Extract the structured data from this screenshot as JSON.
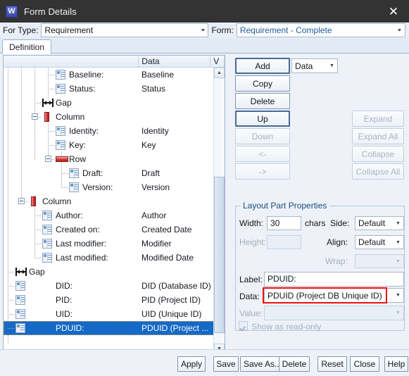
{
  "window": {
    "title": "Form Details",
    "app_icon_letter": "W",
    "close_label": "✕"
  },
  "selector": {
    "for_type_label": "For Type:",
    "for_type_value": "Requirement",
    "form_label": "Form:",
    "form_value": "Requirement - Complete",
    "form_value_color": "#1f5c9e"
  },
  "tabs": [
    {
      "label": "Definition",
      "selected": true
    }
  ],
  "tree": {
    "columns": [
      {
        "key": "label",
        "header": ""
      },
      {
        "key": "data",
        "header": "Data"
      },
      {
        "key": "v",
        "header": "V"
      }
    ],
    "rows": [
      {
        "icon": "field-icon",
        "depth": 4,
        "label": "Baseline:",
        "data": "Baseline",
        "selected": false,
        "expander": "none"
      },
      {
        "icon": "field-icon",
        "depth": 4,
        "label": "Status:",
        "data": "Status",
        "selected": false,
        "expander": "none"
      },
      {
        "icon": "gap-icon",
        "depth": 3,
        "label": "Gap",
        "data": "",
        "selected": false,
        "expander": "none"
      },
      {
        "icon": "column-icon",
        "depth": 3,
        "label": "Column",
        "data": "",
        "selected": false,
        "expander": "collapse"
      },
      {
        "icon": "field-icon",
        "depth": 4,
        "label": "Identity:",
        "data": "Identity",
        "selected": false,
        "expander": "none"
      },
      {
        "icon": "field-icon",
        "depth": 4,
        "label": "Key:",
        "data": "Key",
        "selected": false,
        "expander": "none"
      },
      {
        "icon": "row-icon",
        "depth": 4,
        "label": "Row",
        "data": "",
        "selected": false,
        "expander": "collapse"
      },
      {
        "icon": "field-icon",
        "depth": 5,
        "label": "Draft:",
        "data": "Draft",
        "selected": false,
        "expander": "none"
      },
      {
        "icon": "field-icon",
        "depth": 5,
        "label": "Version:",
        "data": "Version",
        "selected": false,
        "expander": "none"
      },
      {
        "icon": "column-icon",
        "depth": 2,
        "label": "Column",
        "data": "",
        "selected": false,
        "expander": "collapse"
      },
      {
        "icon": "field-icon",
        "depth": 3,
        "label": "Author:",
        "data": "Author",
        "selected": false,
        "expander": "none"
      },
      {
        "icon": "field-icon",
        "depth": 3,
        "label": "Created on:",
        "data": "Created Date",
        "selected": false,
        "expander": "none"
      },
      {
        "icon": "field-icon",
        "depth": 3,
        "label": "Last modifier:",
        "data": "Modifier",
        "selected": false,
        "expander": "none"
      },
      {
        "icon": "field-icon",
        "depth": 3,
        "label": "Last modified:",
        "data": "Modified Date",
        "selected": false,
        "expander": "none"
      },
      {
        "icon": "gap-icon",
        "depth": 1,
        "label": "Gap",
        "data": "",
        "selected": false,
        "expander": "none"
      },
      {
        "icon": "field-icon",
        "depth": 1,
        "label": "DID:",
        "data": "DID (Database ID)",
        "selected": false,
        "expander": "none",
        "label_indent": 2
      },
      {
        "icon": "field-icon",
        "depth": 1,
        "label": "PID:",
        "data": "PID (Project ID)",
        "selected": false,
        "expander": "none",
        "label_indent": 2
      },
      {
        "icon": "field-icon",
        "depth": 1,
        "label": "UID:",
        "data": "UID (Unique ID)",
        "selected": false,
        "expander": "none",
        "label_indent": 2
      },
      {
        "icon": "field-icon",
        "depth": 1,
        "label": "PDUID:",
        "data": "PDUID (Project ...",
        "selected": true,
        "expander": "none",
        "label_indent": 2
      }
    ]
  },
  "actions": {
    "add": {
      "label": "Add",
      "enabled": true,
      "default": true
    },
    "add_kind_combo": {
      "value": "Data"
    },
    "copy": {
      "label": "Copy",
      "enabled": true
    },
    "delete": {
      "label": "Delete",
      "enabled": true
    },
    "up": {
      "label": "Up",
      "enabled": true,
      "default": true
    },
    "down": {
      "label": "Down",
      "enabled": false
    },
    "move_left": {
      "label": "<-",
      "enabled": false
    },
    "move_right": {
      "label": "->",
      "enabled": false
    },
    "expand": {
      "label": "Expand",
      "enabled": false
    },
    "expand_all": {
      "label": "Expand All",
      "enabled": false
    },
    "collapse": {
      "label": "Collapse",
      "enabled": false
    },
    "collapse_all": {
      "label": "Collapse All",
      "enabled": false
    }
  },
  "layout_part_properties": {
    "group_title": "Layout Part Properties",
    "width": {
      "label": "Width:",
      "value": "30",
      "unit": "chars",
      "enabled": true
    },
    "height": {
      "label": "Height:",
      "value": "",
      "enabled": false
    },
    "side": {
      "label": "Side:",
      "value": "Default",
      "enabled": true
    },
    "align": {
      "label": "Align:",
      "value": "Default",
      "enabled": true
    },
    "wrap": {
      "label": "Wrap:",
      "value": "",
      "enabled": false
    },
    "label_field": {
      "label": "Label:",
      "value": "PDUID:",
      "enabled": true
    },
    "data_field": {
      "label": "Data:",
      "value": "PDUID (Project DB Unique ID)",
      "enabled": true,
      "highlight_color": "#ee1111"
    },
    "value_field": {
      "label": "Value:",
      "value": "",
      "enabled": false
    },
    "read_only": {
      "label": "Show as read-only",
      "checked": true,
      "enabled": false
    }
  },
  "footer": {
    "buttons": [
      {
        "label": "Apply"
      },
      {
        "label": "Save"
      },
      {
        "label": "Save As..."
      },
      {
        "label": "Delete"
      },
      {
        "label": "Reset"
      },
      {
        "label": "Close"
      },
      {
        "label": "Help"
      }
    ]
  }
}
